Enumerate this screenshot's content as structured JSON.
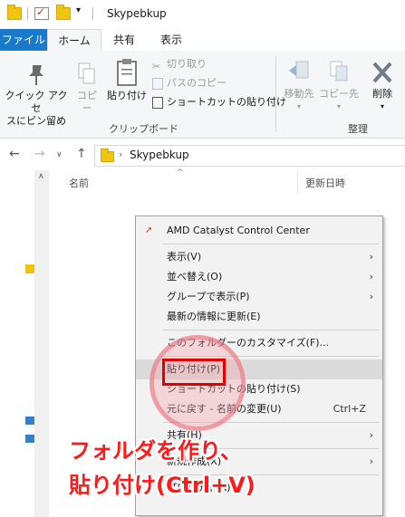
{
  "window": {
    "title": "Skypebkup"
  },
  "tabs": {
    "file": "ファイル",
    "home": "ホーム",
    "share": "共有",
    "view": "表示"
  },
  "ribbon": {
    "pin_quick_access": "クイック アクセ\nスにピン留め",
    "copy": "コピー",
    "paste": "貼り付け",
    "cut": "切り取り",
    "copy_path": "パスのコピー",
    "paste_shortcut": "ショートカットの貼り付け",
    "clipboard_group": "クリップボード",
    "move_to": "移動先",
    "copy_to": "コピー先",
    "delete": "削除",
    "organize_group": "整理"
  },
  "address": {
    "path": "Skypebkup"
  },
  "columns": {
    "name": "名前",
    "date_modified": "更新日時"
  },
  "context_menu": {
    "items": [
      {
        "label": "AMD Catalyst Control Center",
        "shortcut": "",
        "submenu": false
      },
      {
        "label": "表示(V)",
        "shortcut": "",
        "submenu": true
      },
      {
        "label": "並べ替え(O)",
        "shortcut": "",
        "submenu": true
      },
      {
        "label": "グループで表示(P)",
        "shortcut": "",
        "submenu": true
      },
      {
        "label": "最新の情報に更新(E)",
        "shortcut": "",
        "submenu": false
      },
      {
        "label": "このフォルダーのカスタマイズ(F)...",
        "shortcut": "",
        "submenu": false
      },
      {
        "label": "貼り付け(P)",
        "shortcut": "",
        "submenu": false
      },
      {
        "label": "ショートカットの貼り付け(S)",
        "shortcut": "",
        "submenu": false
      },
      {
        "label": "元に戻す - 名前の変更(U)",
        "shortcut": "Ctrl+Z",
        "submenu": false
      },
      {
        "label": "共有(H)",
        "shortcut": "",
        "submenu": true
      },
      {
        "label": "新規作成(X)",
        "shortcut": "",
        "submenu": true
      },
      {
        "label": "プロパティ(R)",
        "shortcut": "",
        "submenu": false
      }
    ]
  },
  "annotation": {
    "line1": "フォルダを作り、",
    "line2": "貼り付け(Ctrl+V)"
  },
  "colors": {
    "accent": "#1979ca",
    "annotation_red": "#ff1a1a",
    "highlight_box": "#e00000"
  }
}
